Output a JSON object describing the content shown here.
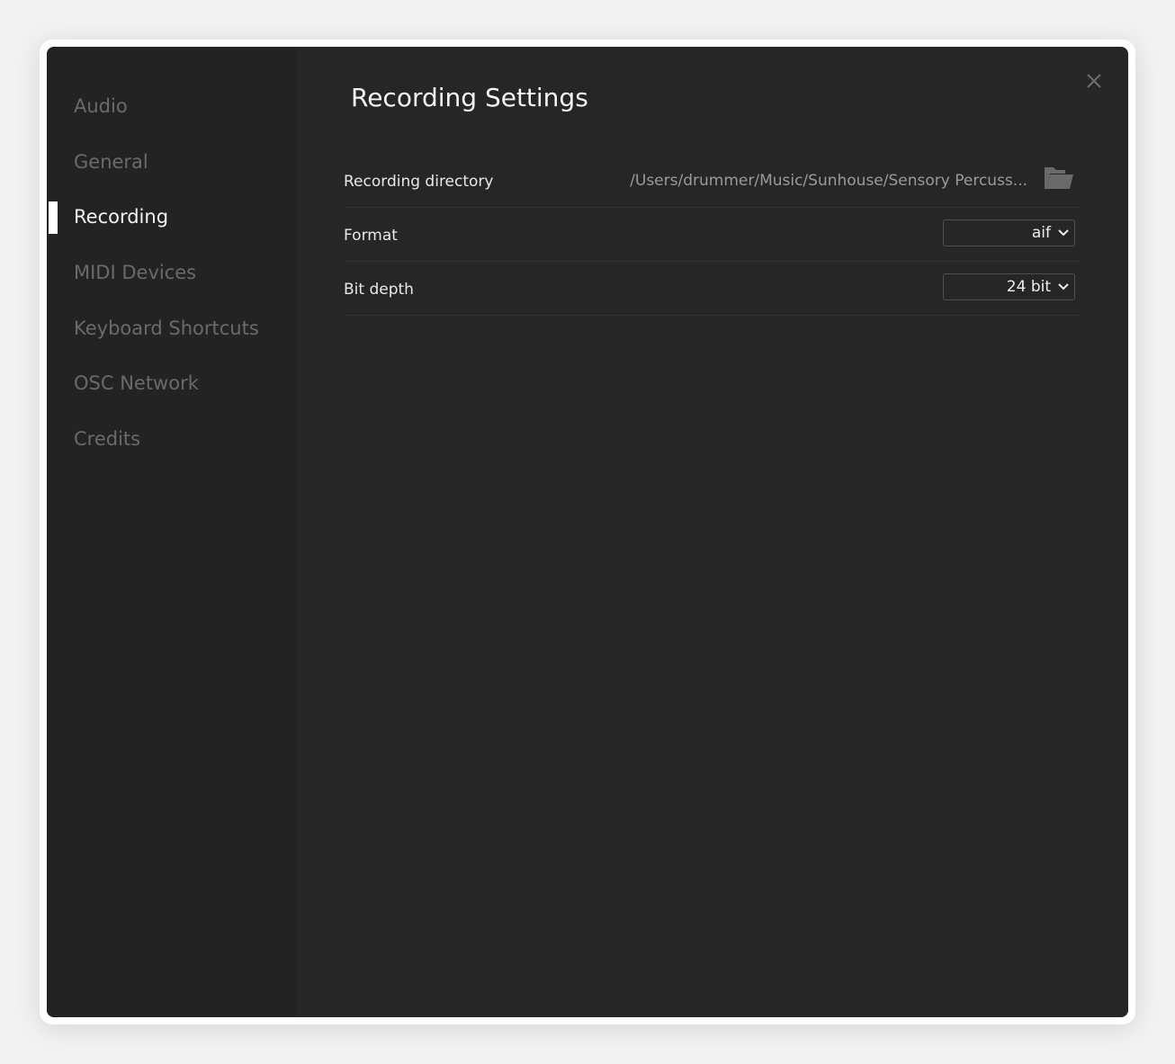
{
  "sidebar": {
    "items": [
      {
        "label": "Audio",
        "active": false
      },
      {
        "label": "General",
        "active": false
      },
      {
        "label": "Recording",
        "active": true
      },
      {
        "label": "MIDI Devices",
        "active": false
      },
      {
        "label": "Keyboard Shortcuts",
        "active": false
      },
      {
        "label": "OSC Network",
        "active": false
      },
      {
        "label": "Credits",
        "active": false
      }
    ]
  },
  "main": {
    "title": "Recording Settings",
    "close_icon": "close-icon",
    "settings": {
      "directory": {
        "label": "Recording directory",
        "value": "/Users/drummer/Music/Sunhouse/Sensory Percuss...",
        "icon": "folder-open-icon"
      },
      "format": {
        "label": "Format",
        "value": "aif"
      },
      "bit_depth": {
        "label": "Bit depth",
        "value": "24 bit"
      }
    }
  },
  "colors": {
    "background": "#262626",
    "sidebar": "#232323",
    "active": "#ffffff",
    "inactive": "#6a6a6a"
  }
}
